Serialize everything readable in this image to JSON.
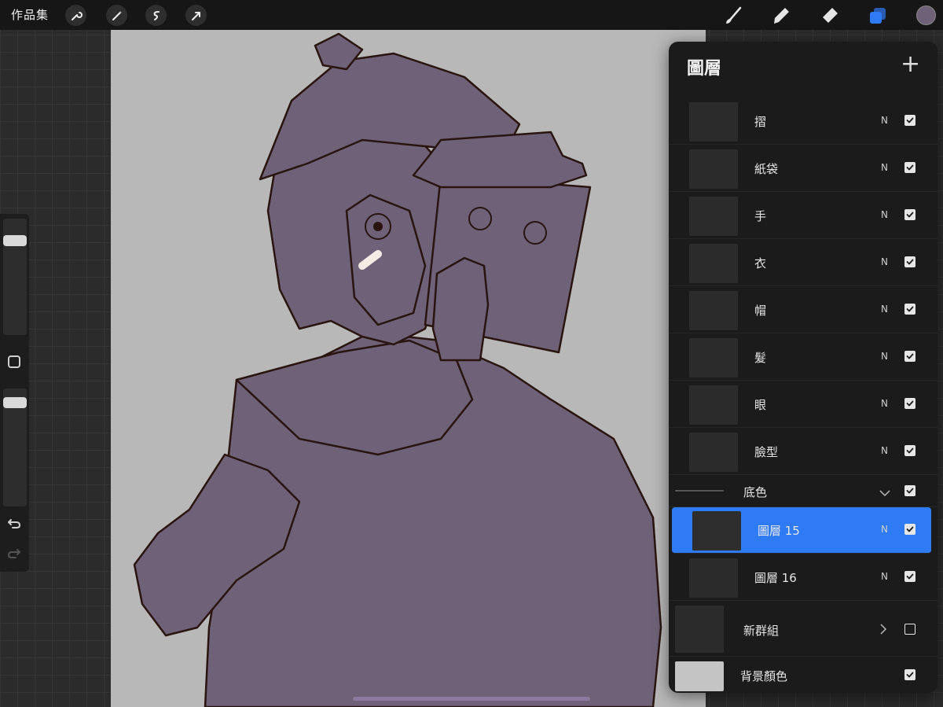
{
  "topbar": {
    "gallery_label": "作品集",
    "left_tools": [
      "wrench-icon",
      "magic-wand-icon",
      "selection-icon",
      "transform-arrow-icon"
    ],
    "right_tools": [
      "brush-icon",
      "smudge-icon",
      "eraser-icon",
      "layers-icon"
    ],
    "current_color": "#6f6278"
  },
  "colors": {
    "accent": "#2f7bf5",
    "panel_bg": "#1b1b1b",
    "canvas_bg": "#b8b8b8",
    "fill_purple": "#6f6278",
    "line_dark": "#2a1410"
  },
  "sidebar": {
    "brush_size_level": 0.16,
    "opacity_level": 0.08
  },
  "layers_panel": {
    "title": "圖層",
    "add_icon": "+",
    "layers": [
      {
        "name": "摺",
        "mode": "N",
        "visible": true
      },
      {
        "name": "紙袋",
        "mode": "N",
        "visible": true
      },
      {
        "name": "手",
        "mode": "N",
        "visible": true
      },
      {
        "name": "衣",
        "mode": "N",
        "visible": true
      },
      {
        "name": "帽",
        "mode": "N",
        "visible": true
      },
      {
        "name": "髮",
        "mode": "N",
        "visible": true
      },
      {
        "name": "眼",
        "mode": "N",
        "visible": true
      },
      {
        "name": "臉型",
        "mode": "N",
        "visible": true
      }
    ],
    "group_base": {
      "name": "底色",
      "visible": true,
      "expanded": true
    },
    "group_layers": [
      {
        "name": "圖層 15",
        "mode": "N",
        "visible": true,
        "selected": true
      },
      {
        "name": "圖層 16",
        "mode": "N",
        "visible": true,
        "selected": false
      }
    ],
    "new_group": {
      "name": "新群組",
      "visible": false
    },
    "background": {
      "name": "背景顏色",
      "visible": true,
      "color": "#c4c4c4"
    }
  }
}
